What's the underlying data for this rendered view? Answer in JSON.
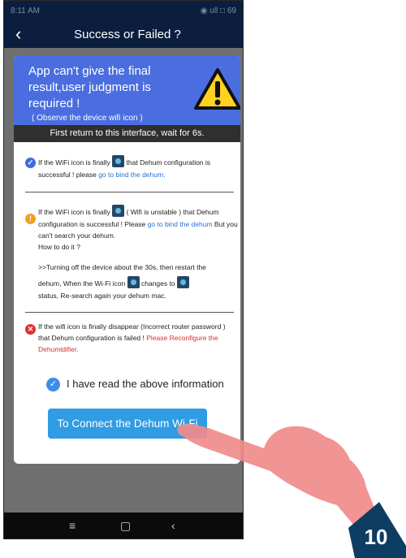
{
  "status_bar": {
    "time": "8:11 AM",
    "icons": "◉ ull □ 69"
  },
  "nav": {
    "back_icon": "‹",
    "title": "Success or Failed ?"
  },
  "banner": {
    "main_text": "App can't give the final result,user judgment is required !",
    "sub_text": "( Observe the device wifi icon )",
    "icon": "warning-triangle-icon"
  },
  "wait_notice": "First return to this interface, wait for 6s.",
  "section1": {
    "pre": "If the WiFi icon is finally",
    "mid": "that Dehum configuration is successful ! please",
    "link": "go to bind the dehum."
  },
  "section2": {
    "pre": "If the WiFi icon is finally",
    "paren": "( Wifi is unstable ) that Dehum configuration is successful ! Please",
    "link": "go to bind the dehum",
    "after": "But you can't search your dehum.",
    "howto": "How to do it ?",
    "step1": ">>Turning off the device about the 30s, then restart the",
    "step2_a": "dehum, When the Wi-Fi icon",
    "step2_b": "changes to",
    "step3": "status, Re-search again your dehum mac."
  },
  "section3": {
    "text": "If the wifi icon is finally disappear (Incorrect router password ) that Dehum configuration is failed !",
    "link": "Please Reconfigure the Dehumidifier."
  },
  "checkbox": {
    "label": "I have read the above information",
    "checked": true
  },
  "connect_button": "To Connect the Dehum Wi-Fi",
  "system_nav": {
    "menu": "≡",
    "home": "▢",
    "back": "‹"
  },
  "step_badge": "10",
  "colors": {
    "accent": "#2f9ce4",
    "banner": "#4a6ee0",
    "header": "#0b1e3d",
    "badge": "#0d3d63",
    "hand": "#f08b8b"
  }
}
